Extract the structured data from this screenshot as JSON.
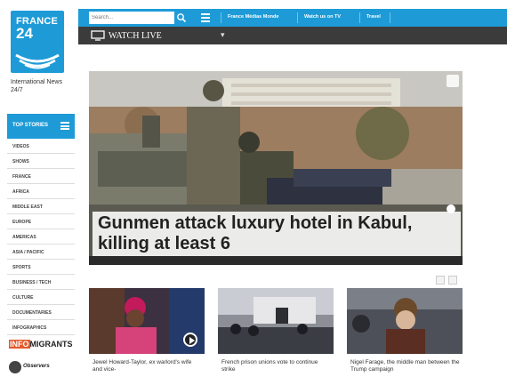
{
  "brand": {
    "logo_line1": "FRANCE",
    "logo_line2": "24",
    "tagline": "International News 24/7"
  },
  "topbar": {
    "search_placeholder": "Search...",
    "links": [
      "France Médias Monde",
      "Watch us on TV",
      "Travel"
    ]
  },
  "watch": {
    "label": "WATCH LIVE",
    "chevron": "▾"
  },
  "sidebar": {
    "top_stories": "TOP STORIES",
    "items": [
      "VIDEOS",
      "SHOWS",
      "FRANCE",
      "AFRICA",
      "MIDDLE EAST",
      "EUROPE",
      "AMERICAS",
      "ASIA / PACIFIC",
      "SPORTS",
      "BUSINESS / TECH",
      "CULTURE",
      "DOCUMENTARIES",
      "INFOGRAPHICS"
    ],
    "infomigrants_a": "INFO",
    "infomigrants_b": "MIGRANTS",
    "observers": "Observers"
  },
  "hero": {
    "headline": "Gunmen attack luxury hotel in Kabul, killing at least 6"
  },
  "cards": [
    {
      "caption": "Jewel Howard-Taylor, ex warlord's wife and vice-"
    },
    {
      "caption": "French prison unions vote to continue strike"
    },
    {
      "caption": "Nigel Farage, the middle man between the Trump campaign"
    }
  ],
  "colors": {
    "accent": "#1e9bd7",
    "dark_bar": "#3b3b3b",
    "infomigrants": "#e35a2a"
  }
}
